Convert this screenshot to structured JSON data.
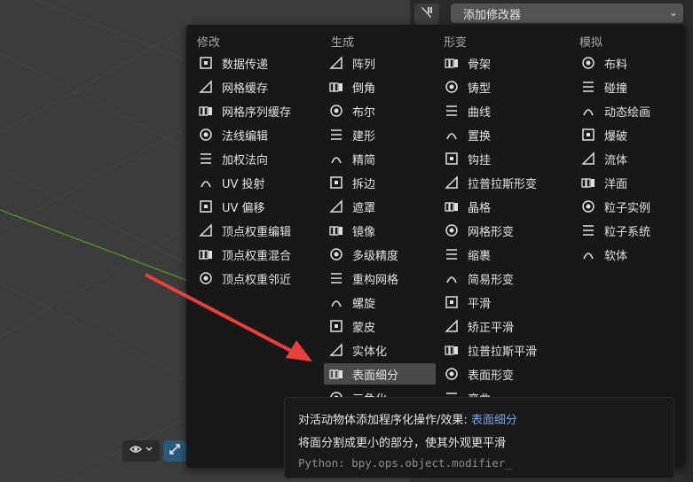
{
  "header": {
    "add_modifier_label": "添加修改器"
  },
  "columns": [
    {
      "title": "修改",
      "items": [
        {
          "label": "数据传递",
          "icon": "data-transfer-icon"
        },
        {
          "label": "网格缓存",
          "icon": "mesh-cache-icon"
        },
        {
          "label": "网格序列缓存",
          "icon": "mesh-sequence-cache-icon"
        },
        {
          "label": "法线编辑",
          "icon": "normal-edit-icon"
        },
        {
          "label": "加权法向",
          "icon": "weighted-normal-icon"
        },
        {
          "label": "UV 投射",
          "icon": "uv-project-icon"
        },
        {
          "label": "UV 偏移",
          "icon": "uv-warp-icon"
        },
        {
          "label": "顶点权重编辑",
          "icon": "vertex-weight-edit-icon"
        },
        {
          "label": "顶点权重混合",
          "icon": "vertex-weight-mix-icon"
        },
        {
          "label": "顶点权重邻近",
          "icon": "vertex-weight-proximity-icon"
        }
      ]
    },
    {
      "title": "生成",
      "items": [
        {
          "label": "阵列",
          "icon": "array-icon"
        },
        {
          "label": "倒角",
          "icon": "bevel-icon"
        },
        {
          "label": "布尔",
          "icon": "boolean-icon"
        },
        {
          "label": "建形",
          "icon": "build-icon"
        },
        {
          "label": "精简",
          "icon": "decimate-icon"
        },
        {
          "label": "拆边",
          "icon": "edge-split-icon"
        },
        {
          "label": "遮罩",
          "icon": "mask-icon"
        },
        {
          "label": "镜像",
          "icon": "mirror-icon"
        },
        {
          "label": "多级精度",
          "icon": "multires-icon"
        },
        {
          "label": "重构网格",
          "icon": "remesh-icon"
        },
        {
          "label": "螺旋",
          "icon": "screw-icon"
        },
        {
          "label": "蒙皮",
          "icon": "skin-icon"
        },
        {
          "label": "实体化",
          "icon": "solidify-icon"
        },
        {
          "label": "表面细分",
          "icon": "subdivision-surface-icon"
        },
        {
          "label": "三角化",
          "icon": "triangulate-icon"
        }
      ]
    },
    {
      "title": "形变",
      "items": [
        {
          "label": "骨架",
          "icon": "armature-icon"
        },
        {
          "label": "铸型",
          "icon": "cast-icon"
        },
        {
          "label": "曲线",
          "icon": "curve-icon"
        },
        {
          "label": "置换",
          "icon": "displace-icon"
        },
        {
          "label": "钩挂",
          "icon": "hook-icon"
        },
        {
          "label": "拉普拉斯形变",
          "icon": "laplacian-deform-icon"
        },
        {
          "label": "晶格",
          "icon": "lattice-icon"
        },
        {
          "label": "网格形变",
          "icon": "mesh-deform-icon"
        },
        {
          "label": "缩裹",
          "icon": "shrinkwrap-icon"
        },
        {
          "label": "简易形变",
          "icon": "simple-deform-icon"
        },
        {
          "label": "平滑",
          "icon": "smooth-icon"
        },
        {
          "label": "矫正平滑",
          "icon": "corrective-smooth-icon"
        },
        {
          "label": "拉普拉斯平滑",
          "icon": "laplacian-smooth-icon"
        },
        {
          "label": "表面形变",
          "icon": "surface-deform-icon"
        },
        {
          "label": "弯曲",
          "icon": "warp-icon"
        }
      ]
    },
    {
      "title": "模拟",
      "items": [
        {
          "label": "布料",
          "icon": "cloth-icon"
        },
        {
          "label": "碰撞",
          "icon": "collision-icon"
        },
        {
          "label": "动态绘画",
          "icon": "dynamic-paint-icon"
        },
        {
          "label": "爆破",
          "icon": "explode-icon"
        },
        {
          "label": "流体",
          "icon": "fluid-icon"
        },
        {
          "label": "洋面",
          "icon": "ocean-icon"
        },
        {
          "label": "粒子实例",
          "icon": "particle-instance-icon"
        },
        {
          "label": "粒子系统",
          "icon": "particle-system-icon"
        },
        {
          "label": "软体",
          "icon": "soft-body-icon"
        }
      ]
    }
  ],
  "highlighted_item": "表面细分",
  "tooltip": {
    "line1_prefix": "对活动物体添加程序化操作/效果: ",
    "line1_highlight": "表面细分",
    "line2": "将面分割成更小的部分，使其外观更平滑",
    "line3": "Python: bpy.ops.object.modifier_"
  },
  "colors": {
    "menu_bg": "#181818",
    "highlight_bg": "#4a4a4a",
    "tooltip_accent": "#7ea6db",
    "arrow": "#e8403a",
    "axis_green": "#4f8c2d"
  }
}
